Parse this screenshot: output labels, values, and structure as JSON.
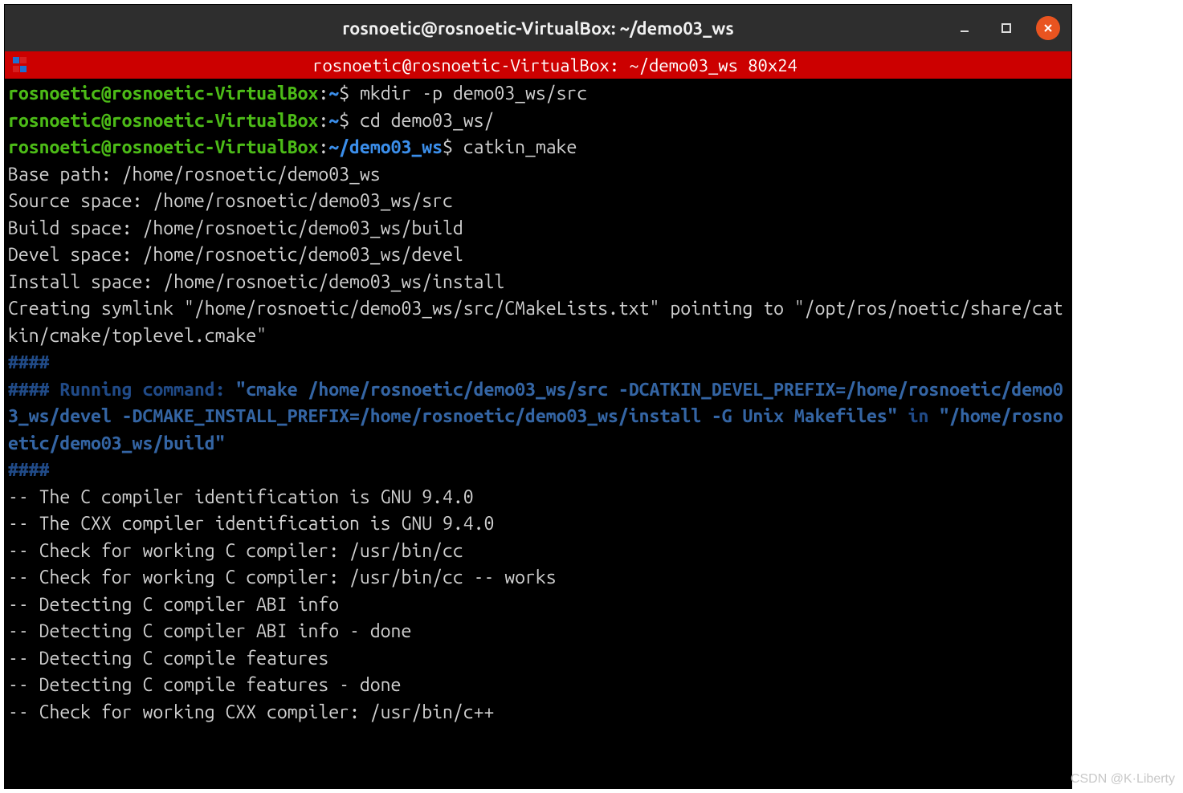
{
  "window": {
    "title": "rosnoetic@rosnoetic-VirtualBox: ~/demo03_ws"
  },
  "menubar": {
    "title": "rosnoetic@rosnoetic-VirtualBox: ~/demo03_ws 80x24"
  },
  "icon_colors": {
    "a": "#1f6fd0",
    "b": "#d51f1f"
  },
  "prompts": [
    {
      "user": "rosnoetic@rosnoetic-VirtualBox",
      "sep": ":",
      "path": "~",
      "dollar": "$ ",
      "cmd": "mkdir -p demo03_ws/src"
    },
    {
      "user": "rosnoetic@rosnoetic-VirtualBox",
      "sep": ":",
      "path": "~",
      "dollar": "$ ",
      "cmd": "cd demo03_ws/"
    },
    {
      "user": "rosnoetic@rosnoetic-VirtualBox",
      "sep": ":",
      "path": "~/demo03_ws",
      "dollar": "$ ",
      "cmd": "catkin_make"
    }
  ],
  "output_pre_hash": [
    "Base path: /home/rosnoetic/demo03_ws",
    "Source space: /home/rosnoetic/demo03_ws/src",
    "Build space: /home/rosnoetic/demo03_ws/build",
    "Devel space: /home/rosnoetic/demo03_ws/devel",
    "Install space: /home/rosnoetic/demo03_ws/install",
    "Creating symlink \"/home/rosnoetic/demo03_ws/src/CMakeLists.txt\" pointing to \"/opt/ros/noetic/share/catkin/cmake/toplevel.cmake\""
  ],
  "hash_lines": {
    "top": "####",
    "prefix": "#### Running command: ",
    "cmd": "\"cmake /home/rosnoetic/demo03_ws/src -DCATKIN_DEVEL_PREFIX=/home/rosnoetic/demo03_ws/devel -DCMAKE_INSTALL_PREFIX=/home/rosnoetic/demo03_ws/install -G Unix Makefiles\"",
    "in": " in ",
    "dir": "\"/home/rosnoetic/demo03_ws/build\"",
    "bottom": "####"
  },
  "output_post_hash": [
    "-- The C compiler identification is GNU 9.4.0",
    "-- The CXX compiler identification is GNU 9.4.0",
    "-- Check for working C compiler: /usr/bin/cc",
    "-- Check for working C compiler: /usr/bin/cc -- works",
    "-- Detecting C compiler ABI info",
    "-- Detecting C compiler ABI info - done",
    "-- Detecting C compile features",
    "-- Detecting C compile features - done",
    "-- Check for working CXX compiler: /usr/bin/c++"
  ],
  "watermark": "CSDN @K·Liberty"
}
